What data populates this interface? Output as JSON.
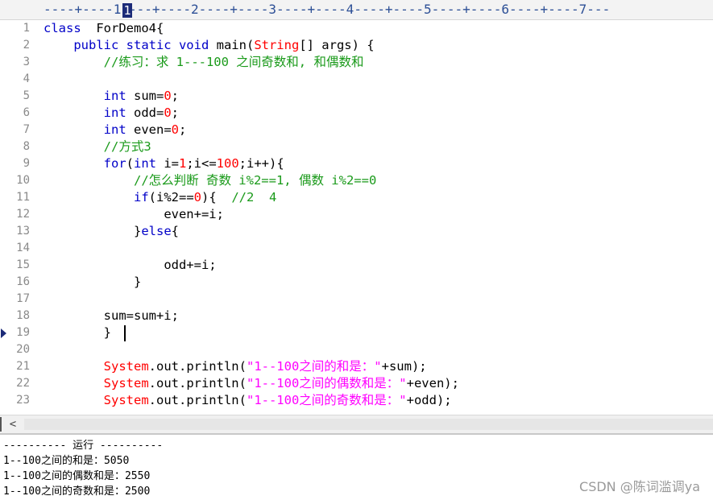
{
  "ruler": {
    "marks": "----+----1----+----2----+----3----+----4----+----5----+----6----+----7---",
    "cursor_col": "1"
  },
  "editor": {
    "lines": [
      {
        "no": "1"
      },
      {
        "no": "2"
      },
      {
        "no": "3"
      },
      {
        "no": "4"
      },
      {
        "no": "5"
      },
      {
        "no": "6"
      },
      {
        "no": "7"
      },
      {
        "no": "8"
      },
      {
        "no": "9"
      },
      {
        "no": "10"
      },
      {
        "no": "11"
      },
      {
        "no": "12"
      },
      {
        "no": "13"
      },
      {
        "no": "14"
      },
      {
        "no": "15"
      },
      {
        "no": "16"
      },
      {
        "no": "17"
      },
      {
        "no": "18"
      },
      {
        "no": "19"
      },
      {
        "no": "20"
      },
      {
        "no": "21"
      },
      {
        "no": "22"
      },
      {
        "no": "23"
      }
    ],
    "code": {
      "l1_kw": "class",
      "l1_rest": "  ForDemo4{",
      "l2_kw": "public static void",
      "l2_mid": " main(",
      "l2_type": "String",
      "l2_rest": "[] args) {",
      "l3_cmt": "//练习：求 1---100 之间奇数和, 和偶数和",
      "l5_kw": "int",
      "l5_a": " sum=",
      "l5_n": "0",
      "l5_b": ";",
      "l6_kw": "int",
      "l6_a": " odd=",
      "l6_n": "0",
      "l6_b": ";",
      "l7_kw": "int",
      "l7_a": " even=",
      "l7_n": "0",
      "l7_b": ";",
      "l8_cmt": "//方式3",
      "l9_kw": "for",
      "l9_a": "(",
      "l9_kw2": "int",
      "l9_b": " i=",
      "l9_n1": "1",
      "l9_c": ";i<=",
      "l9_n2": "100",
      "l9_d": ";i++){",
      "l10_cmt": "//怎么判断 奇数 i%2==1, 偶数 i%2==0",
      "l11_kw": "if",
      "l11_a": "(i%2==",
      "l11_n": "0",
      "l11_b": "){  ",
      "l11_cmt": "//2  4",
      "l12": "even+=i;",
      "l13_a": "}",
      "l13_kw": "else",
      "l13_b": "{",
      "l15": "odd+=i;",
      "l16": "}",
      "l18": "sum=sum+i;",
      "l19": "}",
      "l21_sys": "System",
      "l21_a": ".out.println(",
      "l21_str": "\"1--100之间的和是：\"",
      "l21_b": "+sum);",
      "l22_sys": "System",
      "l22_a": ".out.println(",
      "l22_str": "\"1--100之间的偶数和是：\"",
      "l22_b": "+even);",
      "l23_sys": "System",
      "l23_a": ".out.println(",
      "l23_str": "\"1--100之间的奇数和是：\"",
      "l23_b": "+odd);"
    }
  },
  "scrollbar": {
    "left_arrow": "<"
  },
  "output": {
    "header": "---------- 运行 ----------",
    "lines": [
      "1--100之间的和是：5050",
      "1--100之间的偶数和是：2550",
      "1--100之间的奇数和是：2500"
    ]
  },
  "watermark": "CSDN @陈词滥调ya"
}
